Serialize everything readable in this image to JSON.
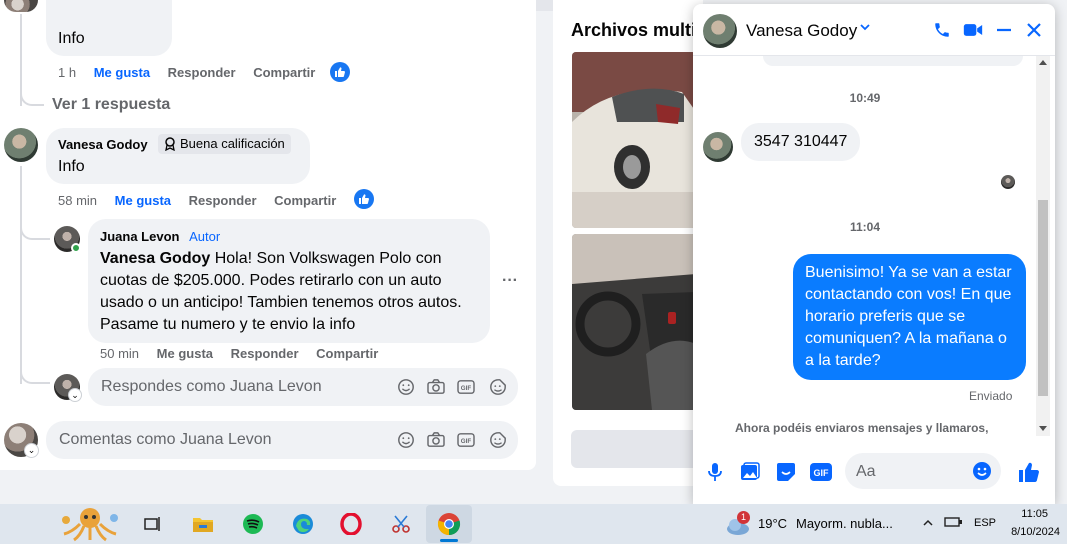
{
  "comments": {
    "prev_reply_text": "Info",
    "prev_reply_meta": {
      "time": "1 h",
      "like": "Me gusta",
      "reply": "Responder",
      "share": "Compartir"
    },
    "view_replies": "Ver 1 respuesta",
    "comment": {
      "author": "Vanesa Godoy",
      "badge": "Buena calificación",
      "text": "Info",
      "meta": {
        "time": "58 min",
        "like": "Me gusta",
        "reply": "Responder",
        "share": "Compartir"
      }
    },
    "reply": {
      "author": "Juana Levon",
      "author_tag": "Autor",
      "mention": "Vanesa Godoy",
      "text": " Hola! Son Volkswagen Polo con cuotas de $205.000. Podes retirarlo con un auto usado o un anticipo! Tambien tenemos otros autos. Pasame tu numero y te envio la info",
      "meta": {
        "time": "50 min",
        "like": "Me gusta",
        "reply": "Responder",
        "share": "Compartir"
      }
    },
    "reply_input_placeholder": "Respondes como Juana Levon",
    "comment_input_placeholder": "Comentas como Juana Levon"
  },
  "media_panel": {
    "title": "Archivos multi"
  },
  "messenger": {
    "contact_name": "Vanesa Godoy",
    "time_1": "10:49",
    "msg_in": "3547 310447",
    "time_2": "11:04",
    "msg_out": "Buenisimo! Ya se van a estar contactando con vos! En que horario preferis que se comuniquen? A la mañana o a la tarde?",
    "status": "Enviado",
    "notice": "Ahora podéis enviaros mensajes y llamaros,",
    "input_placeholder": "Aa"
  },
  "taskbar": {
    "weather_temp": "19°C",
    "weather_desc": "Mayorm. nubla...",
    "weather_badge": "1",
    "lang": "ESP",
    "time": "11:05",
    "date": "8/10/2024"
  },
  "colors": {
    "accent": "#0866ff",
    "bubble_out": "#0a7cff",
    "taskbar": "#dfe6ee"
  }
}
